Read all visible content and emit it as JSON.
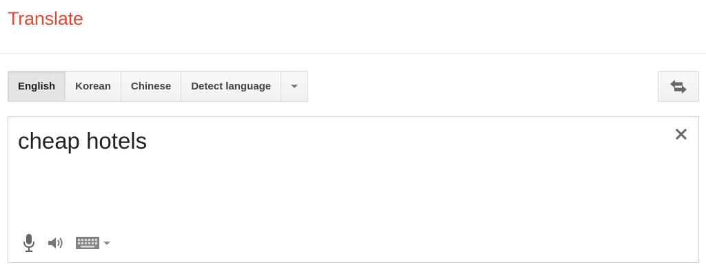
{
  "header": {
    "title": "Translate"
  },
  "languages": {
    "items": [
      {
        "label": "English",
        "active": true
      },
      {
        "label": "Korean",
        "active": false
      },
      {
        "label": "Chinese",
        "active": false
      },
      {
        "label": "Detect language",
        "active": false
      }
    ]
  },
  "source": {
    "text": "cheap hotels"
  },
  "icons": {
    "dropdown": "chevron-down-icon",
    "swap": "swap-languages-icon",
    "clear": "close-icon",
    "mic": "microphone-icon",
    "speaker": "speaker-icon",
    "keyboard": "keyboard-icon"
  },
  "colors": {
    "brand": "#dd4b39"
  }
}
